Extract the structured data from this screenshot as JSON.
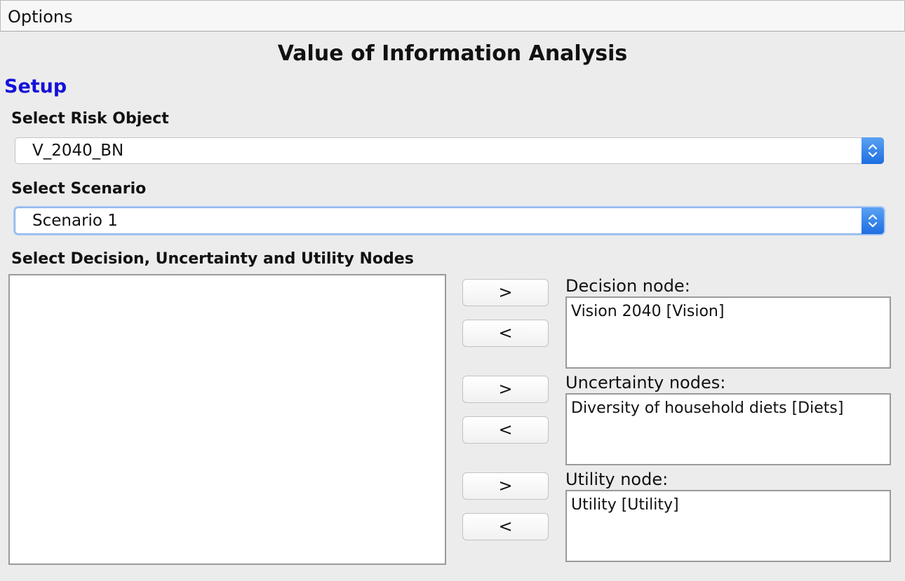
{
  "menu": {
    "options_label": "Options"
  },
  "page": {
    "title": "Value of Information Analysis",
    "section_title": "Setup"
  },
  "risk_object": {
    "label": "Select Risk Object",
    "selected": "V_2040_BN"
  },
  "scenario": {
    "label": "Select Scenario",
    "selected": "Scenario 1"
  },
  "nodes": {
    "label": "Select Decision, Uncertainty and Utility Nodes",
    "available": [],
    "add_label": ">",
    "remove_label": "<",
    "decision": {
      "label": "Decision node:",
      "value": "Vision 2040 [Vision]"
    },
    "uncertainty": {
      "label": "Uncertainty nodes:",
      "value": "Diversity of household diets [Diets]"
    },
    "utility": {
      "label": "Utility node:",
      "value": "Utility [Utility]"
    }
  },
  "icons": {
    "select_arrows": "up-down-chevron-icon"
  },
  "colors": {
    "section_title": "#1411d9",
    "select_arrow_bg": "#2f7fe8",
    "focus_ring": "#a9c8f3"
  }
}
